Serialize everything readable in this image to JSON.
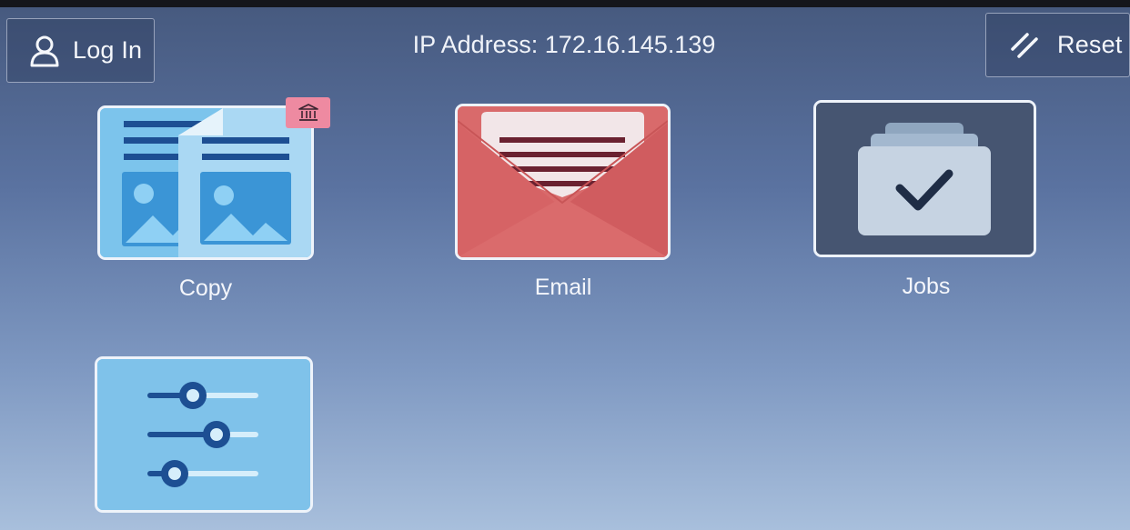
{
  "header": {
    "login_label": "Log In",
    "login_icon": "user-icon",
    "ip_text": "IP Address: 172.16.145.139",
    "reset_label": "Reset",
    "reset_icon": "reset-slash-icon"
  },
  "apps": [
    {
      "label": "Copy",
      "icon": "copy-document-icon",
      "badge_icon": "bank-building-icon",
      "color": "#7cc4ec"
    },
    {
      "label": "Email",
      "icon": "envelope-icon",
      "color": "#d96a6b"
    },
    {
      "label": "Jobs",
      "icon": "jobs-folder-check-icon",
      "color": "#465571"
    },
    {
      "label": "",
      "icon": "settings-sliders-icon",
      "color": "#7fc2ea"
    }
  ],
  "colors": {
    "background_top": "#46597e",
    "background_bottom": "#a8bfdc",
    "badge": "#ee8aa1"
  }
}
